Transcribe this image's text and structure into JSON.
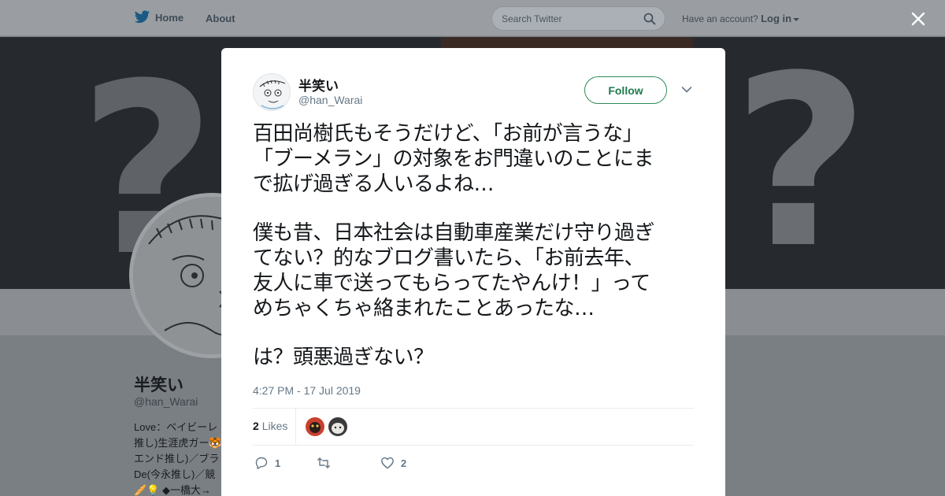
{
  "nav": {
    "home_label": "Home",
    "about_label": "About",
    "search_placeholder": "Search Twitter",
    "account_prompt": "Have an account?",
    "login_label": "Log in"
  },
  "profile": {
    "name": "半笑い",
    "handle": "@han_Warai",
    "bio_lines": [
      "Love：ベイビーレ",
      "推し)生涯虎ガー🐯",
      "エンド推し)／ブラ",
      "De(今永推し)／競",
      "🥖💡 ◆一橋大→"
    ]
  },
  "tweet": {
    "author_name": "半笑い",
    "author_handle": "@han_Warai",
    "follow_label": "Follow",
    "lines": [
      "百田尚樹氏もそうだけど、「お前が言うな」",
      "「ブーメラン」の対象をお門違いのことにま",
      "で拡げ過ぎる人いるよね…",
      "僕も昔、日本社会は自動車産業だけ守り過ぎ",
      "てない？的なブログ書いたら、「お前去年、",
      "友人に車で送ってもらってたやんけ！」って",
      "めちゃくちゃ絡まれたことあったな…",
      "は？頭悪過ぎない？"
    ],
    "timestamp": "4:27 PM - 17 Jul 2019",
    "likes_count": "2",
    "likes_label": "Likes",
    "reply_count": "1",
    "retweet_count": "",
    "like_count": "2"
  },
  "icons": {
    "brand": "twitter-bird-icon",
    "search": "search-icon",
    "close": "close-icon",
    "more": "chevron-down-icon",
    "reply": "reply-icon",
    "retweet": "retweet-icon",
    "like": "heart-icon"
  },
  "colors": {
    "twitter_blue": "#1da1f2",
    "follow_green": "#2e8b57",
    "muted_text": "#657786"
  }
}
